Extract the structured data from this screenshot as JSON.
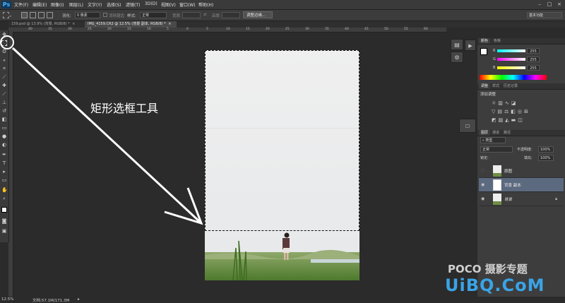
{
  "app": {
    "logo": "Ps"
  },
  "menu": [
    "文件(F)",
    "编辑(E)",
    "图像(I)",
    "图层(L)",
    "文字(Y)",
    "选择(S)",
    "滤镜(T)",
    "3D(D)",
    "视图(V)",
    "窗口(W)",
    "帮助(H)"
  ],
  "window_buttons": [
    "–",
    "□",
    "×"
  ],
  "options": {
    "feather_label": "羽化:",
    "feather_value": "0 像素",
    "antialias_label": "消除锯齿",
    "style_label": "样式:",
    "style_value": "正常",
    "width_label": "宽度:",
    "height_label": "高度:",
    "refine_button": "调整边缘...",
    "workspace": "基本功能"
  },
  "tabs": [
    "159.psd @ 13.9% (背景, RGB/8) *",
    "IMG_4159.CR2 @ 12.5% (背景 副本, RGB/8) *"
  ],
  "tab_close": "×",
  "ruler_top": [
    "40",
    "35",
    "30",
    "25",
    "20",
    "15",
    "10",
    "5",
    "0",
    "5",
    "10",
    "15",
    "20",
    "25",
    "30",
    "35",
    "40",
    "45",
    "50",
    "55",
    "60"
  ],
  "annotation": {
    "label": "矩形选框工具"
  },
  "color_panel": {
    "tabs": [
      "颜色",
      "色板"
    ],
    "channels": [
      {
        "name": "R",
        "value": "255"
      },
      {
        "name": "G",
        "value": "255"
      },
      {
        "name": "B",
        "value": "255"
      }
    ]
  },
  "adjust_panel": {
    "tabs": [
      "调整",
      "样式",
      "历史记录"
    ],
    "title": "添加调整"
  },
  "layers_panel": {
    "tabs": [
      "图层",
      "通道",
      "路径"
    ],
    "filter_label": "类型",
    "blend_mode": "正常",
    "opacity_label": "不透明度:",
    "opacity_value": "100%",
    "lock_label": "锁定:",
    "fill_label": "填充:",
    "fill_value": "100%",
    "layers": [
      {
        "name": "原图",
        "visible": false,
        "selected": false
      },
      {
        "name": "背景 副本",
        "visible": true,
        "selected": true
      },
      {
        "name": "背景",
        "visible": true,
        "selected": false
      }
    ]
  },
  "status": {
    "zoom": "12.5%",
    "doc": "文档:57.1M/171.3M"
  },
  "watermark": {
    "line1": "POCO 摄影专题",
    "line2": "UiBQ.CoM"
  }
}
